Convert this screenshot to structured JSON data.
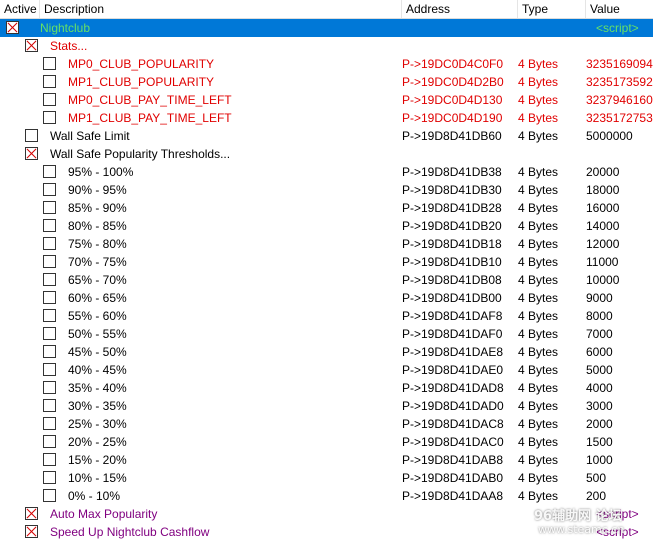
{
  "columns": {
    "active": "Active",
    "description": "Description",
    "address": "Address",
    "type": "Type",
    "value": "Value"
  },
  "selected_row": {
    "description": "Nightclub",
    "value": "<script>"
  },
  "stats_group": {
    "description": "Stats..."
  },
  "stats_items": [
    {
      "description": "MP0_CLUB_POPULARITY",
      "address": "P->19DC0D4C0F0",
      "type": "4 Bytes",
      "value": "3235169094"
    },
    {
      "description": "MP1_CLUB_POPULARITY",
      "address": "P->19DC0D4D2B0",
      "type": "4 Bytes",
      "value": "3235173592"
    },
    {
      "description": "MP0_CLUB_PAY_TIME_LEFT",
      "address": "P->19DC0D4D130",
      "type": "4 Bytes",
      "value": "3237946160"
    },
    {
      "description": "MP1_CLUB_PAY_TIME_LEFT",
      "address": "P->19DC0D4D190",
      "type": "4 Bytes",
      "value": "3235172753"
    }
  ],
  "wall_safe_limit": {
    "description": "Wall Safe Limit",
    "address": "P->19D8D41DB60",
    "type": "4 Bytes",
    "value": "5000000"
  },
  "thresholds_group": {
    "description": "Wall Safe Popularity Thresholds..."
  },
  "threshold_items": [
    {
      "description": "95% - 100%",
      "address": "P->19D8D41DB38",
      "type": "4 Bytes",
      "value": "20000"
    },
    {
      "description": "90% - 95%",
      "address": "P->19D8D41DB30",
      "type": "4 Bytes",
      "value": "18000"
    },
    {
      "description": "85% - 90%",
      "address": "P->19D8D41DB28",
      "type": "4 Bytes",
      "value": "16000"
    },
    {
      "description": "80% - 85%",
      "address": "P->19D8D41DB20",
      "type": "4 Bytes",
      "value": "14000"
    },
    {
      "description": "75% - 80%",
      "address": "P->19D8D41DB18",
      "type": "4 Bytes",
      "value": "12000"
    },
    {
      "description": "70% - 75%",
      "address": "P->19D8D41DB10",
      "type": "4 Bytes",
      "value": "11000"
    },
    {
      "description": "65% - 70%",
      "address": "P->19D8D41DB08",
      "type": "4 Bytes",
      "value": "10000"
    },
    {
      "description": "60% - 65%",
      "address": "P->19D8D41DB00",
      "type": "4 Bytes",
      "value": "9000"
    },
    {
      "description": "55% - 60%",
      "address": "P->19D8D41DAF8",
      "type": "4 Bytes",
      "value": "8000"
    },
    {
      "description": "50% - 55%",
      "address": "P->19D8D41DAF0",
      "type": "4 Bytes",
      "value": "7000"
    },
    {
      "description": "45% - 50%",
      "address": "P->19D8D41DAE8",
      "type": "4 Bytes",
      "value": "6000"
    },
    {
      "description": "40% - 45%",
      "address": "P->19D8D41DAE0",
      "type": "4 Bytes",
      "value": "5000"
    },
    {
      "description": "35% - 40%",
      "address": "P->19D8D41DAD8",
      "type": "4 Bytes",
      "value": "4000"
    },
    {
      "description": "30% - 35%",
      "address": "P->19D8D41DAD0",
      "type": "4 Bytes",
      "value": "3000"
    },
    {
      "description": "25% - 30%",
      "address": "P->19D8D41DAC8",
      "type": "4 Bytes",
      "value": "2000"
    },
    {
      "description": "20% - 25%",
      "address": "P->19D8D41DAC0",
      "type": "4 Bytes",
      "value": "1500"
    },
    {
      "description": "15% - 20%",
      "address": "P->19D8D41DAB8",
      "type": "4 Bytes",
      "value": "1000"
    },
    {
      "description": "10% - 15%",
      "address": "P->19D8D41DAB0",
      "type": "4 Bytes",
      "value": "500"
    },
    {
      "description": "0% - 10%",
      "address": "P->19D8D41DAA8",
      "type": "4 Bytes",
      "value": "200"
    }
  ],
  "auto_max_popularity": {
    "description": "Auto Max Popularity",
    "value": "<script>"
  },
  "speed_up_cashflow": {
    "description": "Speed Up Nightclub Cashflow",
    "value": "<script>"
  },
  "watermark": {
    "line1": "96辅助网 论坛",
    "line2": "www.steamc.cn"
  },
  "colors": {
    "selection": "#0078d7",
    "stats_text": "#e00000",
    "script_text": "#800080",
    "checkbox_cross": "#d40000"
  }
}
